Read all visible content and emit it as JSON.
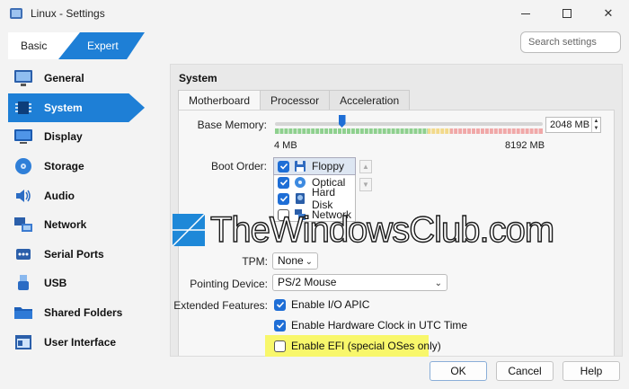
{
  "window": {
    "title": "Linux - Settings"
  },
  "mode_tabs": {
    "basic": "Basic",
    "expert": "Expert"
  },
  "search": {
    "placeholder": "Search settings"
  },
  "sidebar": {
    "items": [
      {
        "label": "General",
        "icon": "monitor-icon"
      },
      {
        "label": "System",
        "icon": "chip-icon",
        "active": true
      },
      {
        "label": "Display",
        "icon": "display-icon"
      },
      {
        "label": "Storage",
        "icon": "disc-icon"
      },
      {
        "label": "Audio",
        "icon": "speaker-icon"
      },
      {
        "label": "Network",
        "icon": "network-icon"
      },
      {
        "label": "Serial Ports",
        "icon": "serial-port-icon"
      },
      {
        "label": "USB",
        "icon": "usb-icon"
      },
      {
        "label": "Shared Folders",
        "icon": "folder-icon"
      },
      {
        "label": "User Interface",
        "icon": "window-icon"
      }
    ]
  },
  "section": {
    "title": "System"
  },
  "tabs": [
    {
      "label": "Motherboard",
      "active": true
    },
    {
      "label": "Processor"
    },
    {
      "label": "Acceleration"
    }
  ],
  "motherboard": {
    "base_memory": {
      "label": "Base Memory:",
      "value": "2048 MB",
      "min": "4 MB",
      "max": "8192 MB",
      "fraction": 0.25
    },
    "boot_order": {
      "label": "Boot Order:",
      "items": [
        {
          "label": "Floppy",
          "checked": true,
          "icon": "floppy-icon"
        },
        {
          "label": "Optical",
          "checked": true,
          "icon": "optical-disc-icon"
        },
        {
          "label": "Hard Disk",
          "checked": true,
          "icon": "hard-disk-icon"
        },
        {
          "label": "Network",
          "checked": false,
          "icon": "network-icon"
        }
      ]
    },
    "tpm": {
      "label": "TPM:",
      "value": "None"
    },
    "pointing_device": {
      "label": "Pointing Device:",
      "value": "PS/2 Mouse"
    },
    "extended_features": {
      "label": "Extended Features:",
      "io_apic": "Enable I/O APIC",
      "utc_clock": "Enable Hardware Clock in UTC Time",
      "efi": "Enable EFI (special OSes only)"
    }
  },
  "watermark": {
    "text": "TheWindowsClub.com"
  },
  "buttons": {
    "ok": "OK",
    "cancel": "Cancel",
    "help": "Help"
  },
  "colors": {
    "accent": "#1e7fd6",
    "highlight": "#f8f76b",
    "track_green": "#8ed08e",
    "track_red": "#f0a8a8"
  }
}
